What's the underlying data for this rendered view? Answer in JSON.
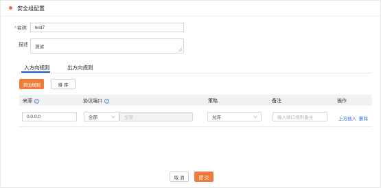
{
  "header": {
    "title": "安全组配置"
  },
  "form": {
    "name": {
      "required_mark": "*",
      "label": "名称",
      "value": "test7"
    },
    "description": {
      "label": "描述",
      "value": "测试"
    }
  },
  "tabs": [
    {
      "label": "入方向规则",
      "active": true
    },
    {
      "label": "出方向规则",
      "active": false
    }
  ],
  "toolbar": {
    "add_rule_label": "添加规则",
    "sort_label": "排 序"
  },
  "table": {
    "columns": [
      "来源",
      "协议端口",
      "策略",
      "备注",
      "操作"
    ],
    "help_icon_glyph": "?",
    "rows": [
      {
        "source": "0.0.0.0",
        "protocol": "全部",
        "port_placeholder": "全部",
        "policy": "允许",
        "remark_placeholder": "输入端口规则备注",
        "action_insert_above": "上方插入",
        "action_delete": "删除"
      }
    ]
  },
  "footer": {
    "cancel_label": "取 消",
    "submit_label": "提 交"
  },
  "colors": {
    "accent": "#ef7b3a",
    "link": "#2c6fcf",
    "tab_ink": "#1f5fbf",
    "required": "#e33333"
  }
}
